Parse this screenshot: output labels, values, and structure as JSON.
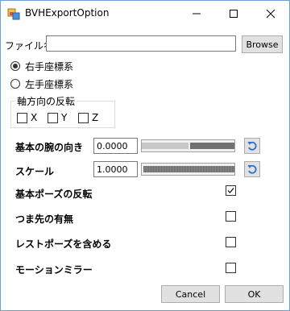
{
  "window": {
    "title": "BVHExportOption"
  },
  "file": {
    "label": "ファイル名",
    "value": "",
    "browse_label": "Browse"
  },
  "coordinate": {
    "options": [
      {
        "label": "右手座標系",
        "selected": true
      },
      {
        "label": "左手座標系",
        "selected": false
      }
    ]
  },
  "axis_flip": {
    "group_label": "軸方向の反転",
    "x_label": "X",
    "y_label": "Y",
    "z_label": "Z",
    "x_checked": false,
    "y_checked": false,
    "z_checked": false
  },
  "arm": {
    "label": "基本の腕の向き",
    "value": "0.0000",
    "slider_fraction": 0.5
  },
  "scale": {
    "label": "スケール",
    "value": "1.0000",
    "slider_fraction": 0.0
  },
  "options": {
    "base_pose_flip": {
      "label": "基本ポーズの反転",
      "checked": true
    },
    "toe": {
      "label": "つま先の有無",
      "checked": false
    },
    "rest_pose": {
      "label": "レストポーズを含める",
      "checked": false
    },
    "motion_mirror": {
      "label": "モーションミラー",
      "checked": false
    }
  },
  "buttons": {
    "cancel": "Cancel",
    "ok": "OK"
  },
  "icons": {
    "app": "app-icon",
    "minimize": "minimize-icon",
    "maximize": "maximize-icon",
    "close": "close-icon",
    "reset": "reset-arrow-icon",
    "check": "checkmark-icon"
  }
}
